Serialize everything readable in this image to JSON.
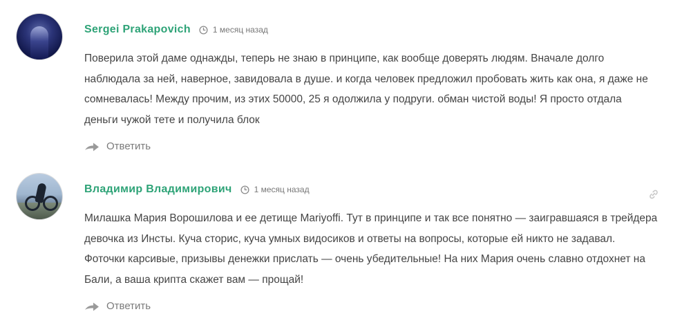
{
  "comments": [
    {
      "author": "Sergei Prakapovich",
      "time": "1 месяц назад",
      "text": "Поверила этой даме однажды, теперь не знаю в принципе, как вообще доверять людям. Вначале долго наблюдала за ней, наверное, завидовала в душе. и когда человек предложил пробовать жить как она, я даже не сомневалась! Между прочим, из этих 50000, 25 я одолжила у подруги. обман чистой воды! Я просто отдала деньги чужой тете и получила блок",
      "reply_label": "Ответить",
      "avatar_icon": "user-avatar-dark-silhouette"
    },
    {
      "author": "Владимир Владимирович",
      "time": "1 месяц назад",
      "text": "Милашка Мария Ворошилова и ее детище Mariyoffi. Тут в принципе и так все понятно — заигравшаяся в трейдера девочка из Инсты. Куча сторис, куча умных видосиков и ответы на вопросы, которые ей никто не задавал. Фоточки карсивые, призывы денежки прислать — очень убедительные! На них Мария очень славно отдохнет на Бали, а ваша крипта скажет вам — прощай!",
      "reply_label": "Ответить",
      "avatar_icon": "user-avatar-cyclist-photo"
    }
  ],
  "colors": {
    "author": "#2ea377",
    "text": "#444444",
    "meta": "#777777",
    "icon": "#9a9a9a"
  }
}
